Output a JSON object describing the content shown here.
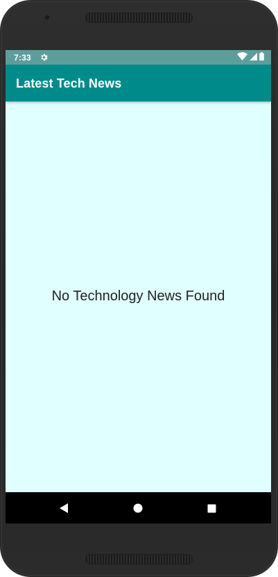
{
  "status_bar": {
    "time": "7:33",
    "icons": [
      "settings-gear-icon",
      "wifi-icon",
      "cellular-signal-icon",
      "battery-icon"
    ],
    "background_color": "#5c9e9c"
  },
  "app_bar": {
    "title": "Latest Tech News",
    "background_color": "#008b8b"
  },
  "content": {
    "empty_message": "No Technology News Found",
    "background_color": "#e0ffff"
  },
  "nav_bar": {
    "buttons": [
      "back-icon",
      "home-icon",
      "recents-icon"
    ]
  }
}
